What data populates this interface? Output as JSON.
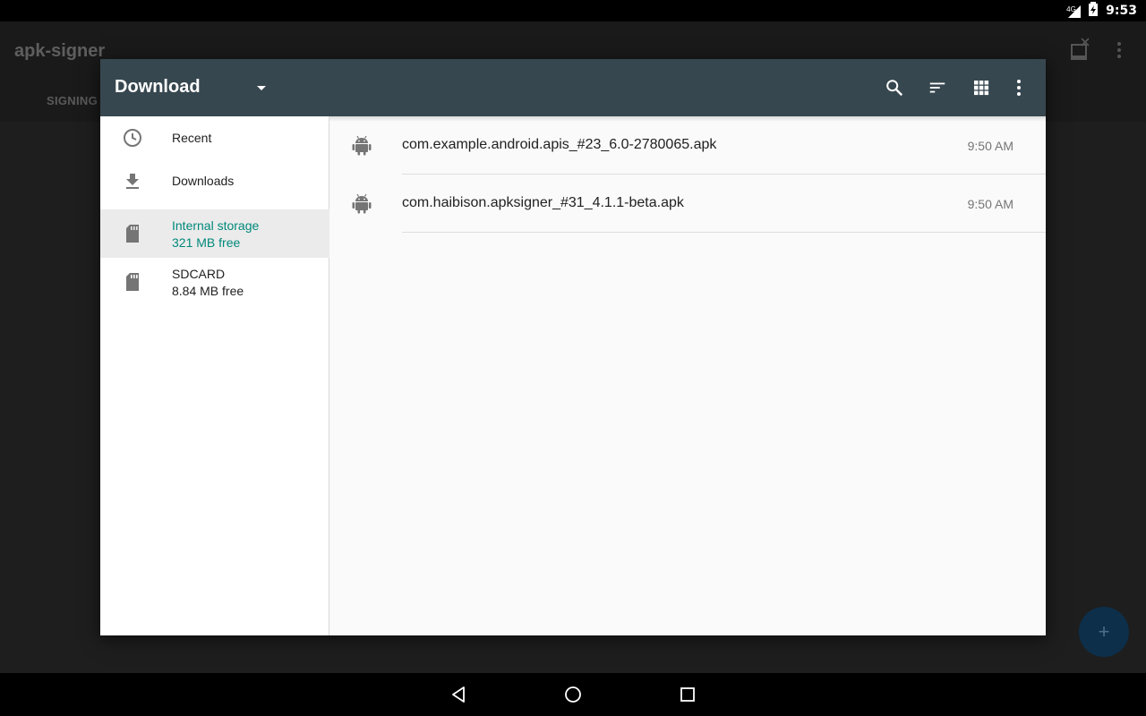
{
  "status_bar": {
    "network_label": "4G",
    "time": "9:53"
  },
  "background_app": {
    "title": "apk-signer",
    "tab_label": "SIGNING",
    "fab_label": "+"
  },
  "dialog": {
    "toolbar": {
      "title": "Download",
      "icons": [
        "arrow-drop-down-icon",
        "search-icon",
        "sort-icon",
        "grid-view-icon",
        "more-vert-icon"
      ],
      "background": "#37474f"
    },
    "roots": [
      {
        "title": "Recent",
        "subtitle": "",
        "icon": "clock-icon"
      },
      {
        "title": "Downloads",
        "subtitle": "",
        "icon": "download-icon"
      },
      {
        "title": "Internal storage",
        "subtitle": "321 MB free",
        "icon": "sd-card-icon",
        "selected": true
      },
      {
        "title": "SDCARD",
        "subtitle": "8.84 MB free",
        "icon": "sd-card-icon"
      }
    ],
    "files": [
      {
        "name": "com.example.android.apis_#23_6.0-2780065.apk",
        "time": "9:50 AM",
        "icon": "android-icon"
      },
      {
        "name": "com.haibison.apksigner_#31_4.1.1-beta.apk",
        "time": "9:50 AM",
        "icon": "android-icon"
      }
    ]
  },
  "accent_color": "#00897b"
}
